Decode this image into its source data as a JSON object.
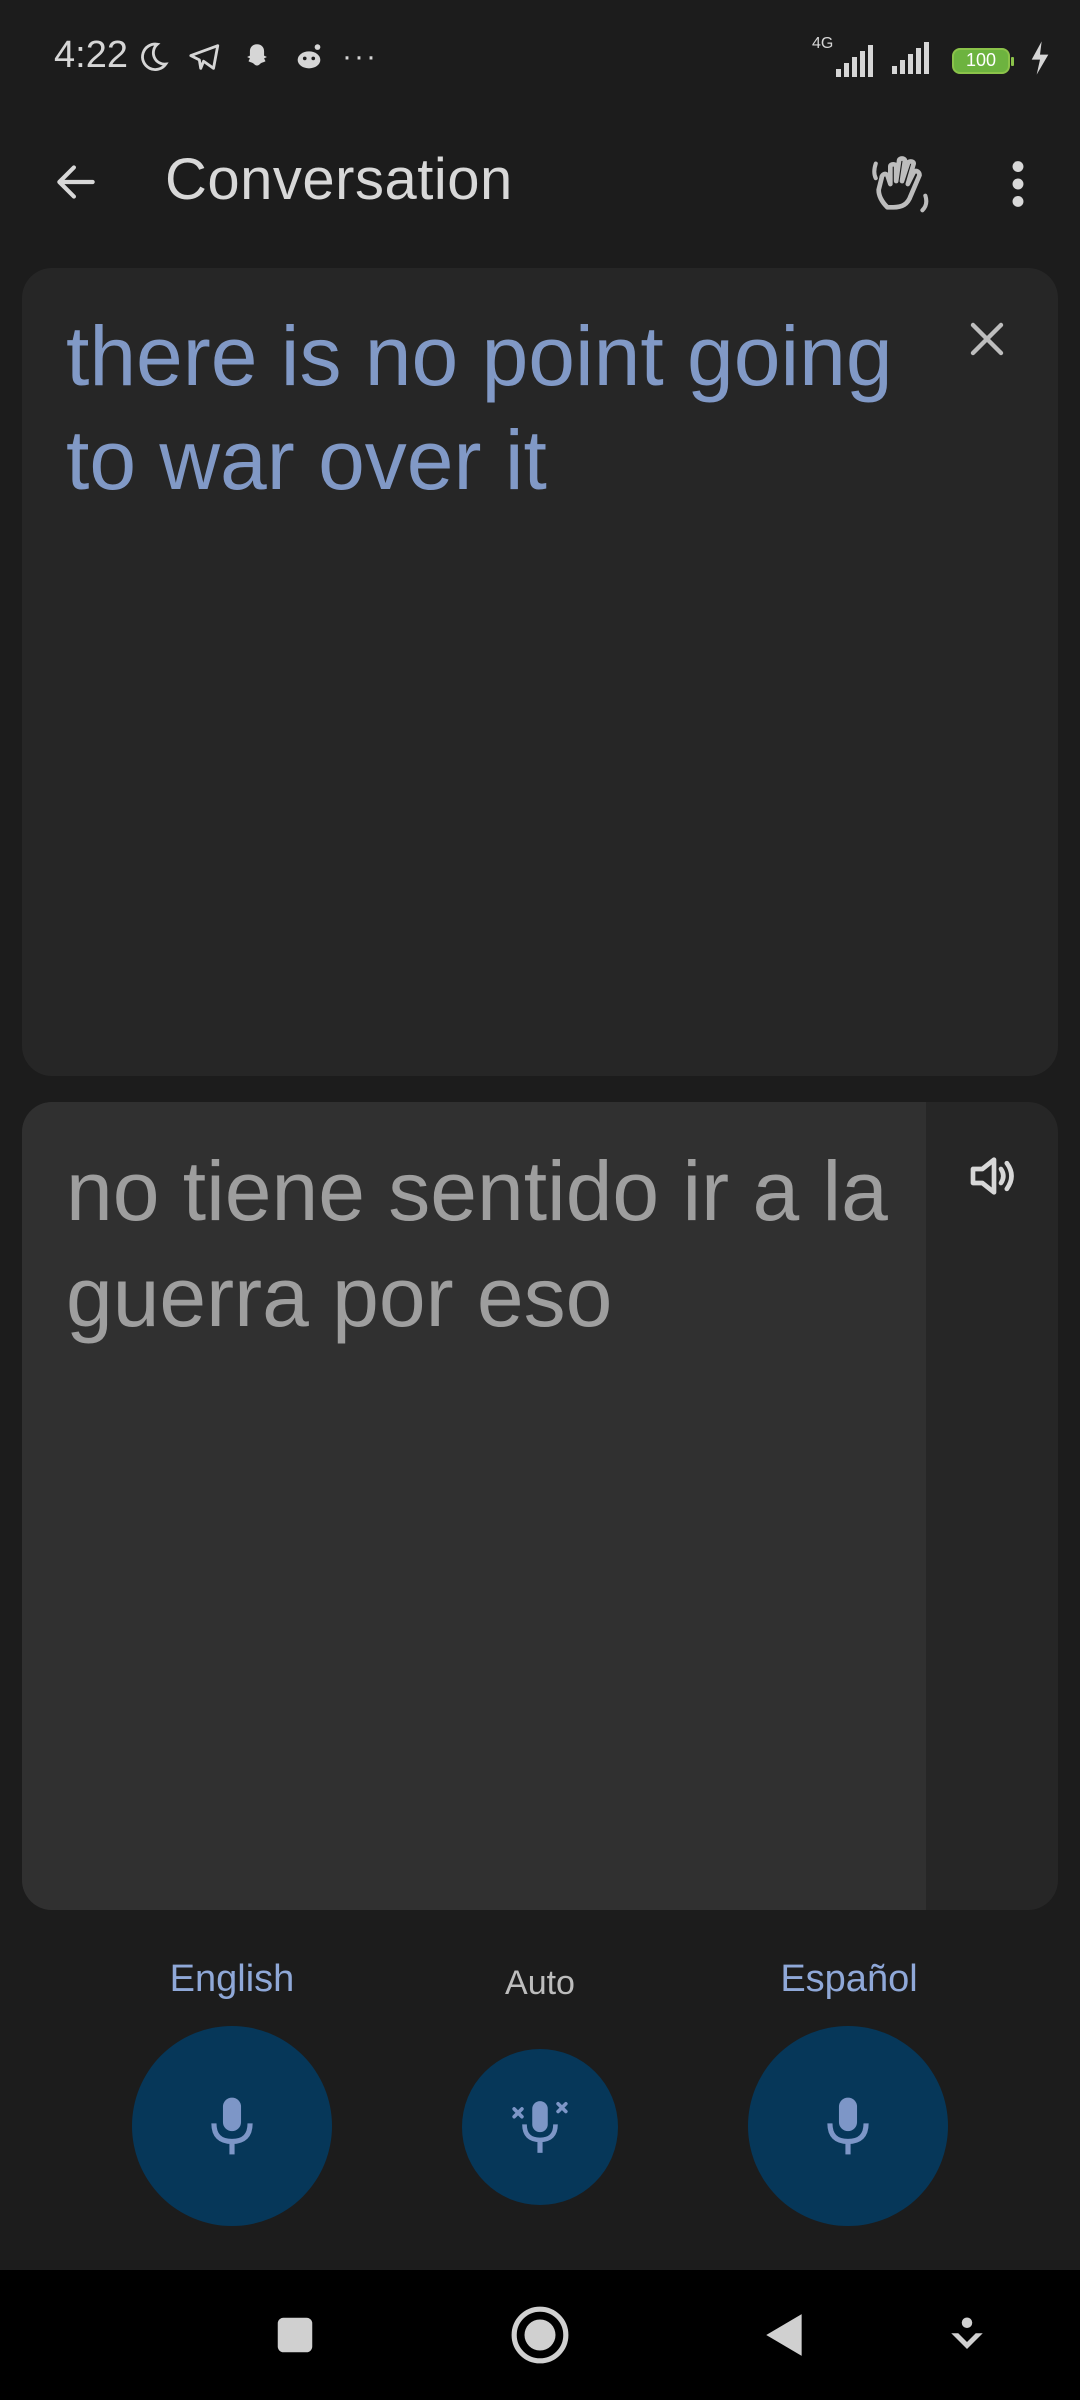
{
  "status_bar": {
    "time": "4:22",
    "network": "4G",
    "battery": "100",
    "icons_left": [
      "moon-icon",
      "telegram-icon",
      "snapchat-icon",
      "reddit-icon"
    ],
    "overflow": "···"
  },
  "app_bar": {
    "title": "Conversation"
  },
  "source": {
    "text": "there is no point going to war over it"
  },
  "translation": {
    "text": "no tiene sentido ir a la guerra por eso"
  },
  "languages": {
    "left": "English",
    "middle": "Auto",
    "right": "Español"
  },
  "colors": {
    "accent_text": "#8199c6",
    "mic_background": "#063759",
    "battery": "#6db33f"
  }
}
